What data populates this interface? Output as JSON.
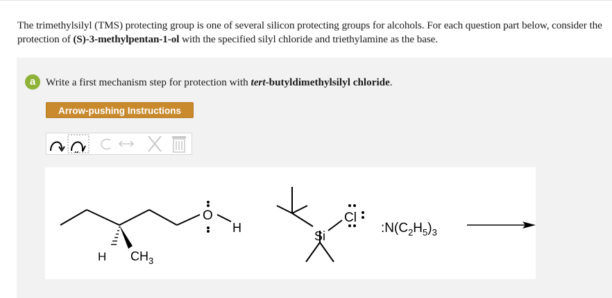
{
  "intro": {
    "part1": "The trimethylsilyl (TMS) protecting group is one of several silicon protecting groups for alcohols. For each question part below, consider the protection of ",
    "compound": "(S)-3-methylpentan-1-ol",
    "part2": " with the specified silyl chloride and triethylamine as the base."
  },
  "question": {
    "badge": "a",
    "prefix": "Write a first mechanism step for protection with ",
    "reagent_italic": "tert",
    "reagent_rest": "-butyldimethylsilyl chloride",
    "suffix": "."
  },
  "instructions_button": "Arrow-pushing Instructions",
  "toolbar": {
    "tools": [
      "curved-arrow-icon",
      "single-electron-arrow-icon",
      "lasso-icon",
      "resonance-arrow-icon",
      "delete-x-icon",
      "trash-icon"
    ]
  },
  "molecules": {
    "alcohol": {
      "O": "O",
      "H": "H",
      "stereo_H": "H",
      "methyl": "CH",
      "methyl_sub": "3"
    },
    "silyl_chloride": {
      "Si": "Si",
      "Cl": "Cl"
    },
    "base": {
      "prefix": ":N(C",
      "sub1": "2",
      "mid": "H",
      "sub2": "5",
      "paren": ")",
      "sub3": "3"
    }
  },
  "colors": {
    "badge": "#8fb338",
    "button": "#c98a2e",
    "panel": "#f2f2f2"
  }
}
